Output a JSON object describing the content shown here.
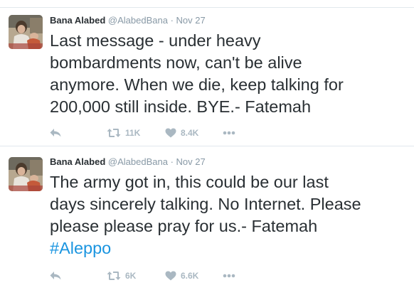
{
  "tweets": [
    {
      "author": {
        "name": "Bana Alabed",
        "handle": "@AlabedBana"
      },
      "separator": "·",
      "date": "Nov 27",
      "text_lines": [
        "Last message - under heavy",
        "bombardments now, can't be alive",
        "anymore. When we die, keep talking for",
        "200,000 still inside. BYE.- Fatemah"
      ],
      "hashtag": "",
      "retweets": "11K",
      "likes": "8.4K",
      "icons": {
        "reply": "reply-icon",
        "retweet": "retweet-icon",
        "like": "heart-icon",
        "more": "more-dots-icon"
      }
    },
    {
      "author": {
        "name": "Bana Alabed",
        "handle": "@AlabedBana"
      },
      "separator": "·",
      "date": "Nov 27",
      "text_lines": [
        "The army got in, this could be our last",
        "days sincerely talking. No Internet. Please",
        "please please pray for us.- Fatemah"
      ],
      "hashtag": "#Aleppo",
      "retweets": "6K",
      "likes": "6.6K",
      "icons": {
        "reply": "reply-icon",
        "retweet": "retweet-icon",
        "like": "heart-icon",
        "more": "more-dots-icon"
      }
    }
  ],
  "colors": {
    "text": "#292f33",
    "muted": "#8899a6",
    "action_icon": "#aab8c2",
    "link": "#1b95e0",
    "divider": "#e1e8ed"
  }
}
